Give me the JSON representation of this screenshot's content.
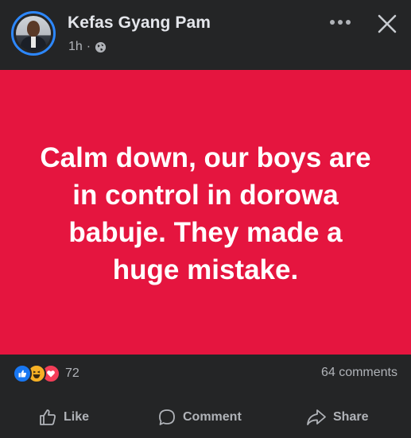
{
  "post": {
    "author": "Kefas Gyang Pam",
    "time": "1h",
    "separator": "·",
    "audience_icon": "globe-icon",
    "text": "Calm down, our boys are in control in dorowa babuje. They made a huge mistake.",
    "background_color": "#e5153f"
  },
  "header_actions": {
    "more_icon": "more-horizontal-icon",
    "close_icon": "close-icon"
  },
  "stats": {
    "reaction_icons": [
      "like-reaction-icon",
      "haha-reaction-icon",
      "love-reaction-icon"
    ],
    "reaction_count": "72",
    "comments": "64 comments"
  },
  "actions": {
    "like": "Like",
    "comment": "Comment",
    "share": "Share"
  },
  "colors": {
    "background": "#242526",
    "accent": "#2d88ff",
    "like_blue": "#1877f2",
    "love_red": "#f33e58",
    "haha_yellow": "#f7b125"
  }
}
